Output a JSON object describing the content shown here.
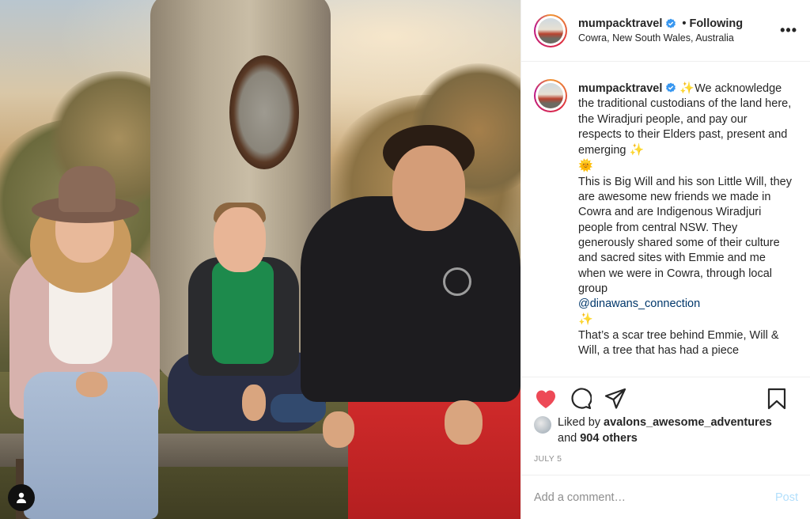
{
  "post": {
    "username": "mumpacktravel",
    "follow_state": "Following",
    "dot": "•",
    "location": "Cowra, New South Wales, Australia",
    "more_label": "•••"
  },
  "caption": {
    "p1": "We acknowledge the traditional custodians of the land here, the Wiradjuri people, and pay our respects to their Elders past, present and emerging",
    "p2": "This is Big Will and his son Little Will, they are awesome new friends we made in Cowra and are Indigenous Wiradjuri people from central NSW. They generously shared some of their culture and sacred sites with Emmie and me when we were in Cowra, through local group",
    "mention": "@dinawans_connection",
    "p3": "That’s a scar tree behind Emmie, Will & Will, a tree that has had a piece",
    "sparkle": "✨",
    "sun": "🌞"
  },
  "likes": {
    "liked_by": "Liked by",
    "liker": "avalons_awesome_adventures",
    "and": "and",
    "others": "904 others"
  },
  "date": "JULY 5",
  "comment": {
    "placeholder": "Add a comment…",
    "post_label": "Post"
  },
  "icons": {
    "heart": "heart-icon",
    "comment": "comment-icon",
    "share": "share-icon",
    "save": "bookmark-icon",
    "verified": "verified-badge-icon",
    "user_tag": "user-tag-icon"
  },
  "colors": {
    "like_red": "#ed4956",
    "verified_blue": "#3897f0",
    "mention_blue": "#00376b",
    "post_disabled": "#b2dffc"
  }
}
